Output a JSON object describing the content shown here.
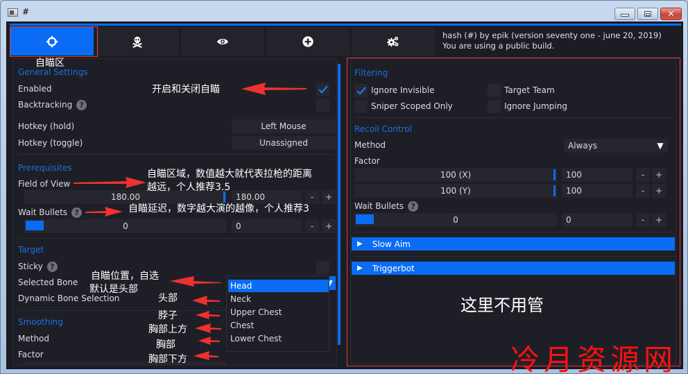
{
  "window": {
    "title": "#",
    "controls": {
      "minimize": "minimize",
      "maximize": "maximize",
      "close": "close"
    }
  },
  "colors": {
    "accent": "#0a6cf5",
    "background": "#1c1d24",
    "panel": "#1e1f26",
    "annotation_red": "#e53a3a"
  },
  "tabs": [
    {
      "name": "aimbot",
      "icon": "crosshair-icon",
      "active": true
    },
    {
      "name": "visuals-skull",
      "icon": "skull-crossbones-icon",
      "active": false
    },
    {
      "name": "esp",
      "icon": "eye-icon",
      "active": false
    },
    {
      "name": "misc",
      "icon": "plus-circle-icon",
      "active": false
    },
    {
      "name": "settings",
      "icon": "gears-icon",
      "active": false
    }
  ],
  "header": {
    "version_line": "hash (#) by epik (version seventy one - june 20, 2019)",
    "build_line": "You are using a public build."
  },
  "left": {
    "general": {
      "title": "General Settings",
      "enabled_label": "Enabled",
      "enabled": true,
      "backtracking_label": "Backtracking",
      "backtracking": false,
      "hotkey_hold_label": "Hotkey (hold)",
      "hotkey_hold_value": "Left Mouse",
      "hotkey_toggle_label": "Hotkey (toggle)",
      "hotkey_toggle_value": "Unassigned"
    },
    "prereq": {
      "title": "Prerequisites",
      "fov_label": "Field of View",
      "fov_slider_value": "180.00",
      "fov_input_value": "180.00",
      "fov_fraction": 1.0,
      "wait_bullets_label": "Wait Bullets",
      "wait_slider_value": "0",
      "wait_input_value": "0"
    },
    "target": {
      "title": "Target",
      "sticky_label": "Sticky",
      "sticky": false,
      "bone_label": "Selected Bone",
      "bone_value": "Head",
      "dynamic_label": "Dynamic Bone Selection",
      "bone_options": [
        "Head",
        "Neck",
        "Upper Chest",
        "Chest",
        "Lower Chest"
      ],
      "selected_index": 0
    },
    "smoothing": {
      "title": "Smoothing",
      "method_label": "Method",
      "factor_label": "Factor"
    }
  },
  "right": {
    "filtering": {
      "title": "Filtering",
      "ignore_invisible": "Ignore Invisible",
      "ignore_invisible_checked": true,
      "target_team": "Target Team",
      "target_team_checked": false,
      "sniper_scoped": "Sniper Scoped Only",
      "sniper_scoped_checked": false,
      "ignore_jumping": "Ignore Jumping",
      "ignore_jumping_checked": false
    },
    "recoil": {
      "title": "Recoil Control",
      "method_label": "Method",
      "method_value": "Always",
      "factor_label": "Factor",
      "factor_x_slider": "100 (X)",
      "factor_x_input": "100",
      "factor_y_slider": "100 (Y)",
      "factor_y_input": "100",
      "wait_bullets_label": "Wait Bullets",
      "wait_slider_value": "0",
      "wait_input_value": "0"
    },
    "slow_aim": "Slow Aim",
    "triggerbot": "Triggerbot"
  },
  "buttons": {
    "minus": "-",
    "plus": "+"
  },
  "annotations": {
    "tab": "自瞄区",
    "enabled": "开启和关闭自瞄",
    "fov_line1": "自瞄区域，数值越大就代表拉枪的距离",
    "fov_line2": "越远，个人推荐3.5",
    "wait": "自瞄延迟，数字越大演的越像，个人推荐3",
    "bone_line1": "自瞄位置，自选",
    "bone_line2": "默认是头部",
    "head": "头部",
    "neck": "脖子",
    "upper_chest": "胸部上方",
    "chest": "胸部",
    "lower_chest": "胸部下方",
    "ignore": "这里不用管",
    "watermark": "冷月资源网"
  }
}
